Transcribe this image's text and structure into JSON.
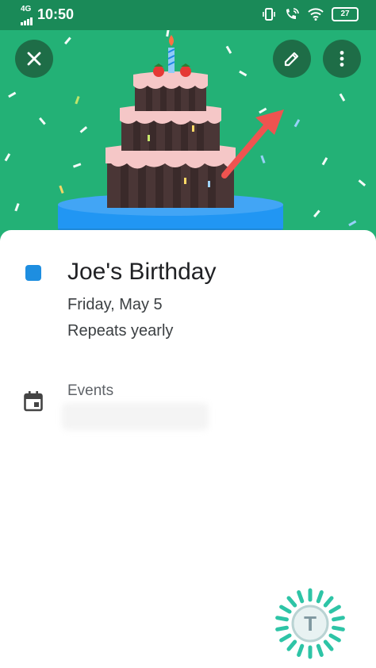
{
  "status_bar": {
    "network": "4G",
    "time": "10:50",
    "battery": "27"
  },
  "header": {
    "background_color": "#23b176",
    "buttons": [
      "close-icon",
      "pencil-icon",
      "more-vert-icon"
    ]
  },
  "event": {
    "title": "Joe's Birthday",
    "date": "Friday, May 5",
    "recurrence": "Repeats yearly",
    "calendar_color": "#1e8ee0",
    "calendar_label": "Events"
  },
  "watermark_letter": "T"
}
